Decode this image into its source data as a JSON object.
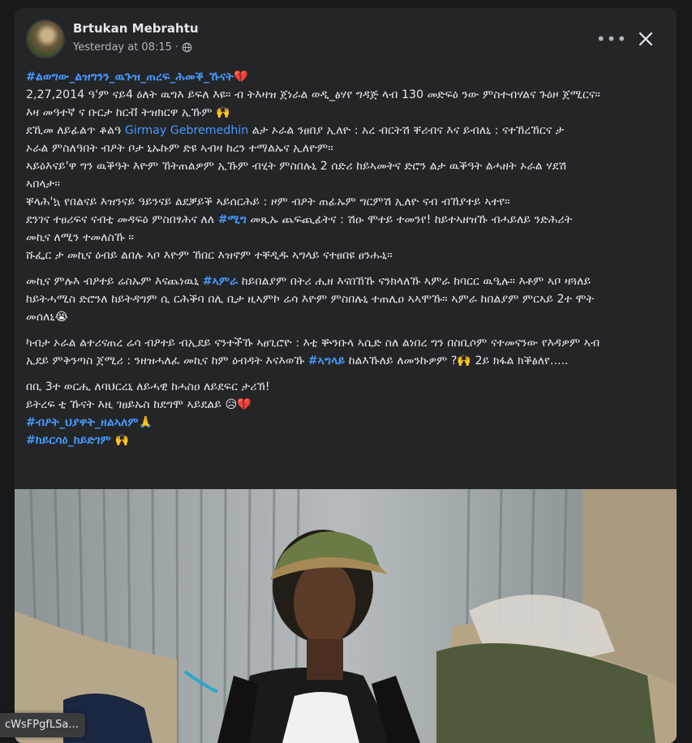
{
  "post": {
    "author": "Brtukan Mebrahtu",
    "timestamp": "Yesterday at 08:15",
    "separator": "·",
    "visibility_icon": "globe-icon",
    "more_label": "•••",
    "close_icon": "close-icon"
  },
  "content": {
    "p1": {
      "l1_tag": "#ልወግው_ልዝግንን_ዉጉዝ_ጠረፍ_ሕመቕ_ኹናት💔",
      "l2": "2,27,2014 ዓ'ም ናይ4 ዕለት ዉግእ ይፍለ እዩ። ብ ትእዛዝ ጀነራል ወዲ_ፅሃየ ግዳጅ ላብ 130 መድፍዕ ንው ምስተብሃልና ጉዕዞ ጀሚርና።",
      "l3": "እዛ መዓተኛ ና ቡርታ ከርቭ ትዝክርዋ ኢኹም 🙌",
      "l4_pre": "ደኺመ ለይፊልጥ ቆልዓ ",
      "l4_mention": "Girmay Gebremedhin",
      "l4_post": "  ልታ ኦራል ንፀበያ ኢለዮ : አረ ብርትሽ ቐሪብና እና ይብለኒ : ናተኸረኸርና ታ",
      "l5": "ኦራል ምስለዓበት ብዖት ቦታ ኒኡኩም ድዩ ኣብዛ ከረን ተማልኡና ኢለዮም፡፡",
      "l6": "ኣይዕእናይ'ዋ ግን ዉቕዓት እዮም ኸትጠልዎም ኢኹም ብሂት ምስበሉኒ 2 ሰድሪ ከይኣመትና ድሮን ልታ ዉቕዓት ልሓዘት ኦራል ሃደሽ",
      "l7": "ኣበላታ።",
      "l8": "ቐላሕ'ኳ የበልናይ እዝንናይ ዓይንናይ ልደቓይቕ ኣይሰርሕይ : ዞም ብዖት ጠፊኡም ግርምሽ ኢለዮ ናብ ብኸያተይ ኣተየ።",
      "l9_pre": "ደንገና ተፀሪፍና ናብቲ መዳፍዕ ምስበፃሕና ለለ ",
      "l9_tag": "#ሚግ",
      "l9_post": " መጺኡ ጨፍጪፊትና : ሽዑ ሞተይ ተመንየ! ከይተኣዘዝኹ ብሓይለይ ንድሕሪት",
      "l10": "መኪና ለሚን ተመለስኹ ።",
      "l11": "ሹፌር ታ መኪና ዕብይ ልበሉ ኣቦ እዮም ኸበር እዝኖም ተቐዲዱ ኣግላይ ናተፀበዩ ፀንሑኒ።"
    },
    "p2": {
      "l1_pre": "መኪና ምሉእ ብዖተይ ሬስኡም እናጨነዉኒ ",
      "l1_tag": "#ኣምራ",
      "l1_post": " ከይበልያም በትሪ ሒዘ እናበኸኹ ናንክላለኹ ኣምራ ከባርር ዉዒሉ። እቶም ኣቦ ዛጓለይ",
      "l2": "ከይትሓሚስ ድሮንለ ከይትዳግም ሲ ርሕቕባ በሊ ቢታ ዚኣምኮ ሬሳ እዮም ምስበሉኒ ተጠሊዐ ኣኣሞኹ። ኣምራ ከበልያም ምርኣይ 2ተ ሞት",
      "l3": "መሰለኒ😭"
    },
    "p3": {
      "l1": "ካብታ ኦራል ልተሪናጠረ ሬሳ ብዖተይ ብኢደይ ናንተችኹ ኣፀጊሮዮ : እቲ ቝንቡላ ኣሲድ ስለ ልነበረ ግን በስቢሶም ናተመናንው የእዳዎም ኣብ",
      "l2_pre": "ኢደይ ምቅንጣስ ጀሚሪ : ንዘዝሓለፈ መኪና ከም ዕብዳት እናእወኹ ",
      "l2_tag": "#ኣግላይ",
      "l2_post": " ከልእኹለይ ለመንኩዎም ?🙌 2ይ ክፋል ክቕፅለየ....."
    },
    "p4": {
      "l1": "በቢ 3ተ ወርሒ ለባህርረኒ ለይሓዊ ከሓስዐ ለይደፍር ታሪኽ!",
      "l2": "ይትረፍ ቲ ኹናት እዚ ገፀይኡስ ከደግሞ ኣይደልይ 😥💔",
      "l3_tag": "#ብዖት_ህያዋት_ዘልኣለም🙏",
      "l4_tag": "#ከይርሳዕ_ከይድገም 🙌"
    }
  },
  "url_chip": "cWsFPgfLSa..."
}
